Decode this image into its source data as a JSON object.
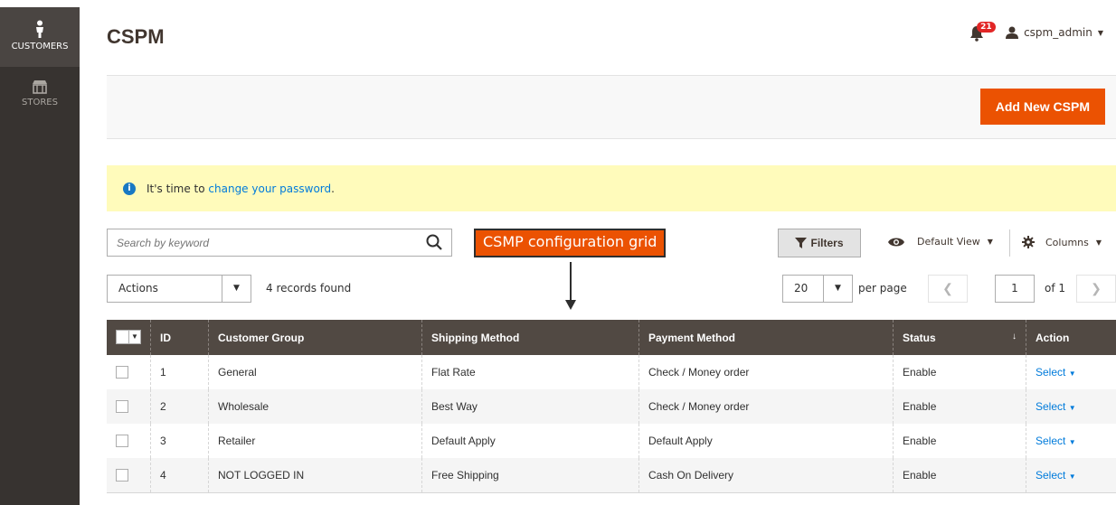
{
  "sidebar": {
    "items": [
      {
        "label": "CUSTOMERS",
        "icon": "person-icon",
        "active": true
      },
      {
        "label": "STORES",
        "icon": "storefront-icon",
        "active": false
      }
    ]
  },
  "header": {
    "title": "CSPM",
    "notifications_count": "21",
    "user": "cspm_admin"
  },
  "actionbar": {
    "add_label": "Add New CSPM"
  },
  "notice": {
    "prefix": "It's time to ",
    "link": "change your password",
    "suffix": "."
  },
  "toolbar": {
    "search_placeholder": "Search by keyword",
    "callout": "CSMP configuration grid",
    "filters_label": "Filters",
    "view_label": "Default View",
    "columns_label": "Columns",
    "actions_label": "Actions",
    "records_found": "4 records found",
    "per_page_value": "20",
    "per_page_label": "per page",
    "page_current": "1",
    "page_of": "of 1"
  },
  "grid": {
    "headers": {
      "id": "ID",
      "group": "Customer Group",
      "shipping": "Shipping Method",
      "payment": "Payment Method",
      "status": "Status",
      "action": "Action"
    },
    "rows": [
      {
        "id": "1",
        "group": "General",
        "shipping": "Flat Rate",
        "payment": "Check / Money order",
        "status": "Enable",
        "action": "Select"
      },
      {
        "id": "2",
        "group": "Wholesale",
        "shipping": "Best Way",
        "payment": "Check / Money order",
        "status": "Enable",
        "action": "Select"
      },
      {
        "id": "3",
        "group": "Retailer",
        "shipping": "Default Apply",
        "payment": "Default Apply",
        "status": "Enable",
        "action": "Select"
      },
      {
        "id": "4",
        "group": "NOT LOGGED IN",
        "shipping": "Free Shipping",
        "payment": "Cash On Delivery",
        "status": "Enable",
        "action": "Select"
      }
    ]
  },
  "colors": {
    "accent": "#eb5202",
    "sidebar": "#373330",
    "table_header": "#514943",
    "link": "#007bdb",
    "notice_bg": "#fffbbb"
  }
}
